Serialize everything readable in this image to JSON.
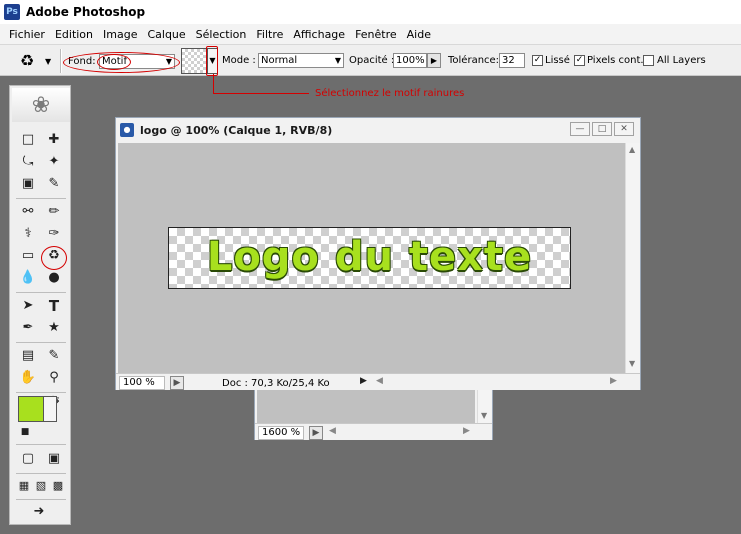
{
  "app": {
    "title": "Adobe Photoshop",
    "icon_label": "Ps"
  },
  "menu": [
    "Fichier",
    "Edition",
    "Image",
    "Calque",
    "Sélection",
    "Filtre",
    "Affichage",
    "Fenêtre",
    "Aide"
  ],
  "options": {
    "tool_icon": "paint-bucket-icon",
    "fond_label": "Fond:",
    "fond_value": "Motif",
    "mode_label": "Mode :",
    "mode_value": "Normal",
    "opacity_label": "Opacité :",
    "opacity_value": "100%",
    "tolerance_label": "Tolérance:",
    "tolerance_value": "32",
    "lisse_label": "Lissé",
    "lisse_checked": true,
    "pixels_label": "Pixels cont.",
    "pixels_checked": true,
    "all_layers_label": "All Layers",
    "all_layers_checked": false
  },
  "annotation": {
    "text": "Sélectionnez le motif rainures",
    "color": "#d40000"
  },
  "colors": {
    "foreground": "#a8e01e",
    "background": "#f5f5f5"
  },
  "document_main": {
    "title": "logo @ 100% (Calque 1, RVB/8)",
    "zoom": "100 %",
    "doc_info": "Doc : 70,3 Ko/25,4 Ko",
    "logo_text": "Logo du texte"
  },
  "document_back": {
    "zoom": "1600 %"
  }
}
